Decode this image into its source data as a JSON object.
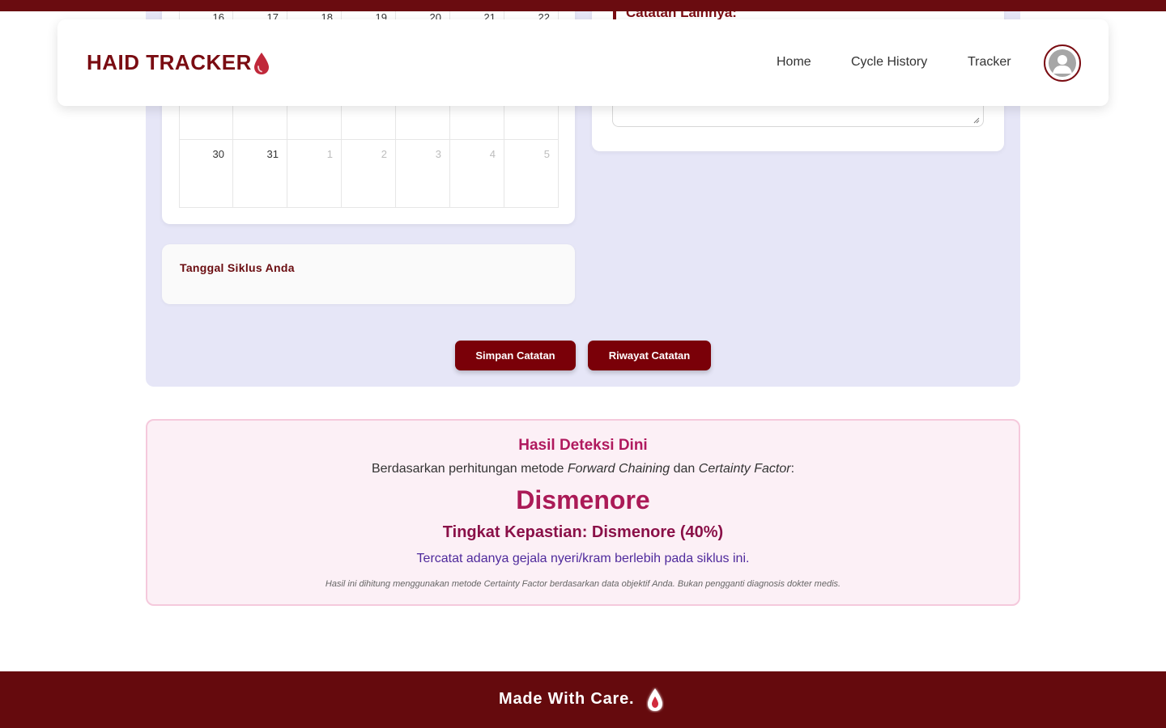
{
  "app": {
    "brand": "HAID TRACKER",
    "brand_icon": "blood-drop-icon",
    "accent": "#7a0c12"
  },
  "nav": {
    "items": [
      {
        "label": "Home"
      },
      {
        "label": "Cycle History"
      },
      {
        "label": "Tracker"
      }
    ],
    "avatar_icon": "user-avatar-icon"
  },
  "calendar": {
    "top_row": [
      "16",
      "17",
      "18",
      "19",
      "20",
      "21",
      "22"
    ],
    "last_row": [
      {
        "day": "30",
        "muted": false
      },
      {
        "day": "31",
        "muted": false
      },
      {
        "day": "1",
        "muted": true
      },
      {
        "day": "2",
        "muted": true
      },
      {
        "day": "3",
        "muted": true
      },
      {
        "day": "4",
        "muted": true
      },
      {
        "day": "5",
        "muted": true
      }
    ]
  },
  "notes": {
    "label": "Catatan Lainnya:",
    "value": ""
  },
  "cycle": {
    "title": "Tanggal Siklus Anda"
  },
  "actions": {
    "save_label": "Simpan Catatan",
    "history_label": "Riwayat Catatan"
  },
  "result": {
    "title": "Hasil Deteksi Dini",
    "method_prefix": "Berdasarkan perhitungan metode ",
    "method_1": "Forward Chaining",
    "method_mid": " dan ",
    "method_2": "Certainty Factor",
    "method_suffix": ":",
    "diagnosis": "Dismenore",
    "certainty_label": "Tingkat Kepastian: Dismenore (40%)",
    "certainty_percent": 40,
    "description": "Tercatat adanya gejala nyeri/kram berlebih pada siklus ini.",
    "disclaimer": "Hasil ini dihitung menggunakan metode Certainty Factor berdasarkan data objektif Anda. Bukan pengganti diagnosis dokter medis."
  },
  "footer": {
    "text": "Made With Care.",
    "icon": "blood-drop-icon"
  }
}
